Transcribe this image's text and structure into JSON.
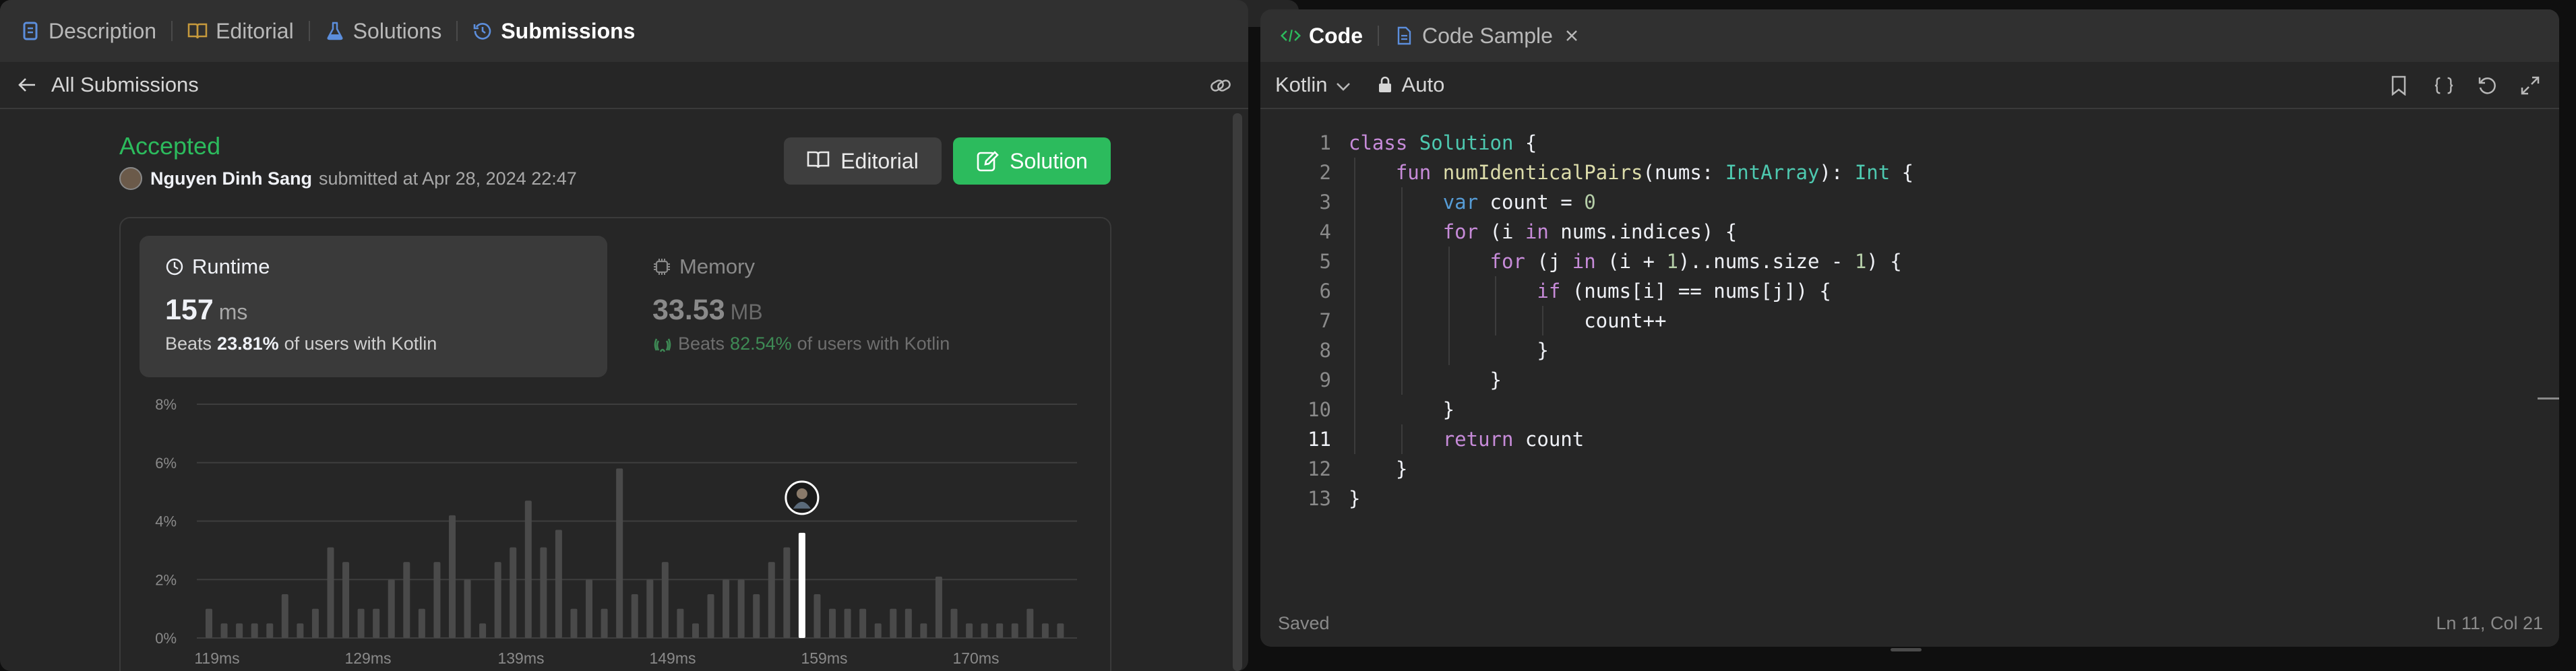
{
  "left_tabs": [
    {
      "label": "Description",
      "icon": "description-icon",
      "color": "#5c8edc"
    },
    {
      "label": "Editorial",
      "icon": "book-icon",
      "color": "#c69a3c"
    },
    {
      "label": "Solutions",
      "icon": "flask-icon",
      "color": "#5c8edc"
    },
    {
      "label": "Submissions",
      "icon": "history-icon",
      "color": "#5c8edc",
      "active": true
    }
  ],
  "subbar": {
    "back_label": "All Submissions"
  },
  "submission": {
    "status": "Accepted",
    "author": "Nguyen Dinh Sang",
    "submitted_text": "submitted at Apr 28, 2024 22:47"
  },
  "buttons": {
    "editorial": "Editorial",
    "solution": "Solution"
  },
  "runtime": {
    "label": "Runtime",
    "value": "157",
    "unit": "ms",
    "beats_prefix": "Beats",
    "beats_pct": "23.81%",
    "beats_suffix": "of users with Kotlin"
  },
  "memory": {
    "label": "Memory",
    "value": "33.53",
    "unit": "MB",
    "beats_prefix": "Beats",
    "beats_pct": "82.54%",
    "beats_suffix": "of users with Kotlin"
  },
  "chart_data": {
    "type": "bar",
    "y_ticks": [
      "8%",
      "6%",
      "4%",
      "2%",
      "0%"
    ],
    "ylim": [
      0,
      8
    ],
    "x_tick_labels": [
      "119ms",
      "129ms",
      "139ms",
      "149ms",
      "159ms",
      "170ms"
    ],
    "values": [
      1.0,
      0.5,
      0.5,
      0.5,
      0.5,
      1.5,
      0.5,
      1.0,
      3.1,
      2.6,
      1.0,
      1.0,
      2.0,
      2.6,
      1.0,
      2.6,
      4.2,
      2.0,
      0.5,
      2.6,
      3.1,
      4.7,
      3.1,
      3.7,
      1.0,
      2.0,
      1.0,
      5.8,
      1.5,
      2.0,
      2.6,
      1.0,
      0.5,
      1.5,
      2.0,
      2.0,
      1.5,
      2.6,
      3.1,
      3.6,
      1.5,
      1.0,
      1.0,
      1.0,
      0.5,
      1.0,
      1.0,
      0.5,
      2.1,
      1.0,
      0.5,
      0.5,
      0.5,
      0.5,
      1.0,
      0.5,
      0.5
    ],
    "highlight_index": 39,
    "grid": true
  },
  "editor": {
    "tabs": [
      {
        "label": "Code",
        "icon": "code-icon",
        "active": true
      },
      {
        "label": "Code Sample",
        "icon": "file-icon",
        "closable": true
      }
    ],
    "language": "Kotlin",
    "mode": "Auto",
    "current_line": 11,
    "lines": [
      "class Solution {",
      "    fun numIdenticalPairs(nums: IntArray): Int {",
      "        var count = 0",
      "        for (i in nums.indices) {",
      "            for (j in (i + 1)..nums.size - 1) {",
      "                if (nums[i] == nums[j]) {",
      "                    count++",
      "                }",
      "            }",
      "        }",
      "        return count",
      "    }",
      "}"
    ],
    "status_left": "Saved",
    "status_right": "Ln 11, Col 21"
  }
}
